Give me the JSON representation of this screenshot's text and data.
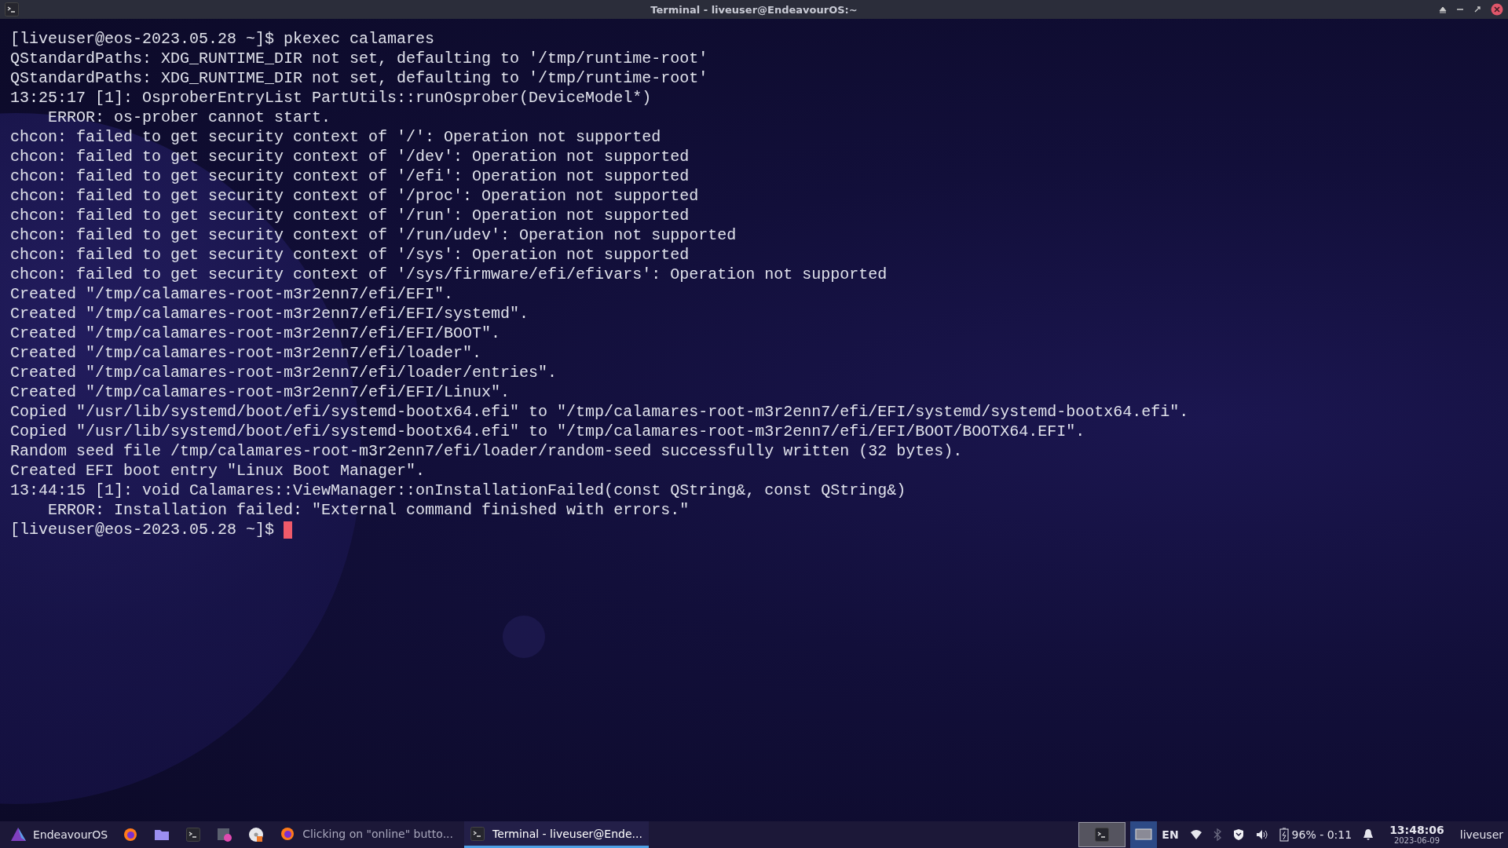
{
  "window": {
    "title": "Terminal - liveuser@EndeavourOS:~"
  },
  "terminal": {
    "lines": [
      "[liveuser@eos-2023.05.28 ~]$ pkexec calamares",
      "QStandardPaths: XDG_RUNTIME_DIR not set, defaulting to '/tmp/runtime-root'",
      "QStandardPaths: XDG_RUNTIME_DIR not set, defaulting to '/tmp/runtime-root'",
      "13:25:17 [1]: OsproberEntryList PartUtils::runOsprober(DeviceModel*)",
      "    ERROR: os-prober cannot start.",
      "chcon: failed to get security context of '/': Operation not supported",
      "chcon: failed to get security context of '/dev': Operation not supported",
      "chcon: failed to get security context of '/efi': Operation not supported",
      "chcon: failed to get security context of '/proc': Operation not supported",
      "chcon: failed to get security context of '/run': Operation not supported",
      "chcon: failed to get security context of '/run/udev': Operation not supported",
      "chcon: failed to get security context of '/sys': Operation not supported",
      "chcon: failed to get security context of '/sys/firmware/efi/efivars': Operation not supported",
      "Created \"/tmp/calamares-root-m3r2enn7/efi/EFI\".",
      "Created \"/tmp/calamares-root-m3r2enn7/efi/EFI/systemd\".",
      "Created \"/tmp/calamares-root-m3r2enn7/efi/EFI/BOOT\".",
      "Created \"/tmp/calamares-root-m3r2enn7/efi/loader\".",
      "Created \"/tmp/calamares-root-m3r2enn7/efi/loader/entries\".",
      "Created \"/tmp/calamares-root-m3r2enn7/efi/EFI/Linux\".",
      "Copied \"/usr/lib/systemd/boot/efi/systemd-bootx64.efi\" to \"/tmp/calamares-root-m3r2enn7/efi/EFI/systemd/systemd-bootx64.efi\".",
      "Copied \"/usr/lib/systemd/boot/efi/systemd-bootx64.efi\" to \"/tmp/calamares-root-m3r2enn7/efi/EFI/BOOT/BOOTX64.EFI\".",
      "Random seed file /tmp/calamares-root-m3r2enn7/efi/loader/random-seed successfully written (32 bytes).",
      "Created EFI boot entry \"Linux Boot Manager\".",
      "13:44:15 [1]: void Calamares::ViewManager::onInstallationFailed(const QString&, const QString&)",
      "    ERROR: Installation failed: \"External command finished with errors.\""
    ],
    "prompt": "[liveuser@eos-2023.05.28 ~]$ "
  },
  "taskbar": {
    "start": "EndeavourOS",
    "launchers": [
      {
        "kind": "browser"
      },
      {
        "kind": "folder"
      },
      {
        "kind": "terminal"
      },
      {
        "kind": "app"
      },
      {
        "kind": "disc"
      }
    ],
    "tasks": [
      {
        "kind": "browser",
        "label": "Clicking on \"online\" butto...",
        "selected": false
      },
      {
        "kind": "terminal",
        "label": "Terminal - liveuser@Ende...",
        "selected": true
      }
    ],
    "show_desktop": {
      "selected": true
    },
    "keyboard": "EN",
    "battery": "96% - 0:11",
    "clock": {
      "time": "13:48:06",
      "date": "2023-06-09"
    },
    "user": "liveuser"
  }
}
